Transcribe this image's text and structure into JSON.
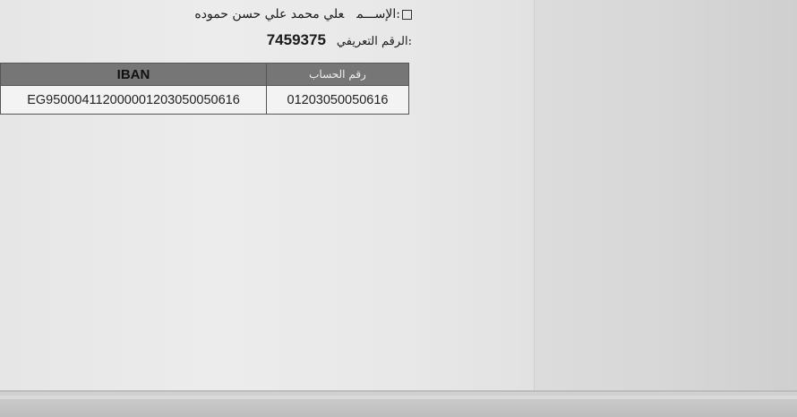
{
  "profile": {
    "name_label": ":الإســـم",
    "name_value": "علي محمد  علي حسن حموده",
    "id_label": ":الرقم التعريفي",
    "id_value": "7459375"
  },
  "account_table": {
    "headers": {
      "iban": "IBAN",
      "account_number": "رقم الحساب"
    },
    "rows": [
      {
        "iban": "EG950004112000001203050050616",
        "account_number": "01203050050616"
      }
    ]
  }
}
